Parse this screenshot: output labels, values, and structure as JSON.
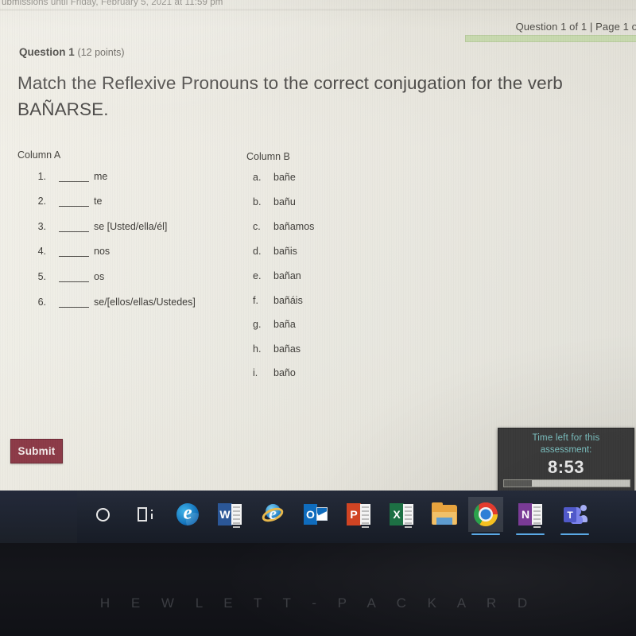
{
  "quiz": {
    "clipped_top_line": "ubmissions until Friday, February 5, 2021 at 11:59 pm",
    "header_status": "Question 1 of 1 | Page 1 o",
    "question_number": "Question 1",
    "question_points": "(12 points)",
    "prompt": "Match the Reflexive Pronouns to the correct conjugation for the verb BAÑARSE.",
    "column_a_header": "Column A",
    "column_b_header": "Column B",
    "column_a": [
      {
        "index": "1.",
        "blank": "",
        "text": "me"
      },
      {
        "index": "2.",
        "blank": "",
        "text": "te"
      },
      {
        "index": "3.",
        "blank": "",
        "text": "se [Usted/ella/él]"
      },
      {
        "index": "4.",
        "blank": "",
        "text": "nos"
      },
      {
        "index": "5.",
        "blank": "",
        "text": "os"
      },
      {
        "index": "6.",
        "blank": "",
        "text": "se/[ellos/ellas/Ustedes]"
      }
    ],
    "column_b": [
      {
        "letter": "a.",
        "option": "bañe"
      },
      {
        "letter": "b.",
        "option": "bañu"
      },
      {
        "letter": "c.",
        "option": "bañamos"
      },
      {
        "letter": "d.",
        "option": "bañis"
      },
      {
        "letter": "e.",
        "option": "bañan"
      },
      {
        "letter": "f.",
        "option": "bañáis"
      },
      {
        "letter": "g.",
        "option": "baña"
      },
      {
        "letter": "h.",
        "option": "bañas"
      },
      {
        "letter": "i.",
        "option": "baño"
      }
    ],
    "submit_label": "Submit",
    "submit_color": "#8c3a47",
    "progress_bar_color": "#c7d9ae"
  },
  "timer": {
    "label_line1": "Time left for this",
    "label_line2": "assessment:",
    "value": "8:53",
    "label_color": "#7fc6c6",
    "panel_color": "#3b3b3b",
    "bar_fill_percent": 22
  },
  "taskbar": {
    "background_color": "#1e2430",
    "items": [
      {
        "name": "cortana",
        "label": "Cortana",
        "active": false
      },
      {
        "name": "task-view",
        "label": "Task View",
        "active": false
      },
      {
        "name": "microsoft-edge",
        "label": "Microsoft Edge",
        "active": false
      },
      {
        "name": "word",
        "label": "Word",
        "letter": "W",
        "active": false
      },
      {
        "name": "internet-explorer",
        "label": "Internet Explorer",
        "active": false
      },
      {
        "name": "outlook",
        "label": "Outlook",
        "letter": "O",
        "active": false
      },
      {
        "name": "powerpoint",
        "label": "PowerPoint",
        "letter": "P",
        "active": false
      },
      {
        "name": "excel",
        "label": "Excel",
        "letter": "X",
        "active": false
      },
      {
        "name": "file-explorer",
        "label": "File Explorer",
        "active": false
      },
      {
        "name": "chrome",
        "label": "Google Chrome",
        "active": true
      },
      {
        "name": "onenote",
        "label": "OneNote",
        "letter": "N",
        "active": false
      },
      {
        "name": "teams",
        "label": "Microsoft Teams",
        "letter": "T",
        "active": false
      }
    ]
  },
  "device": {
    "brand": "H E W L E T T - P A C K A R D"
  }
}
